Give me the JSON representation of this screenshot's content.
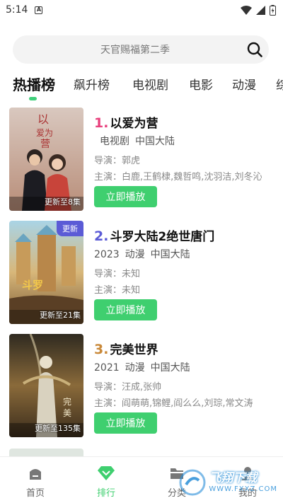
{
  "status": {
    "time": "5:14"
  },
  "search": {
    "placeholder": "天官赐福第二季"
  },
  "tabs": [
    {
      "label": "热播榜",
      "active": true
    },
    {
      "label": "飙升榜"
    },
    {
      "label": "电视剧"
    },
    {
      "label": "电影"
    },
    {
      "label": "动漫"
    },
    {
      "label": "综"
    }
  ],
  "items": [
    {
      "rank": "1.",
      "rank_color": "#e8417d",
      "title": "以爱为营",
      "year": "",
      "genre": "电视剧",
      "region": "中国大陆",
      "director": "导演：郭虎",
      "cast": "主演：白鹿,王鹤棣,魏哲鸣,沈羽洁,刘冬沁",
      "episodes": "更新至8集",
      "tag": "",
      "play_label": "立即播放"
    },
    {
      "rank": "2.",
      "rank_color": "#5b5bd6",
      "title": "斗罗大陆2绝世唐门",
      "year": "2023",
      "genre": "动漫",
      "region": "中国大陆",
      "director": "导演：未知",
      "cast": "主演：未知",
      "episodes": "更新至21集",
      "tag": "更新",
      "play_label": "立即播放"
    },
    {
      "rank": "3.",
      "rank_color": "#c9893a",
      "title": "完美世界",
      "year": "2021",
      "genre": "动漫",
      "region": "中国大陆",
      "director": "导演：汪成,张帅",
      "cast": "主演：阎萌萌,锦鲤,阎么么,刘琮,常文涛",
      "episodes": "更新至135集",
      "tag": "",
      "play_label": "立即播放"
    }
  ],
  "bottom_nav": [
    {
      "label": "首页",
      "icon": "home-icon"
    },
    {
      "label": "排行",
      "icon": "rank-diamond-icon",
      "active": true
    },
    {
      "label": "分类",
      "icon": "folder-icon"
    },
    {
      "label": "我的",
      "icon": "user-icon"
    }
  ],
  "colors": {
    "accent": "#3fcf6f",
    "tag": "#5b5bd6"
  }
}
